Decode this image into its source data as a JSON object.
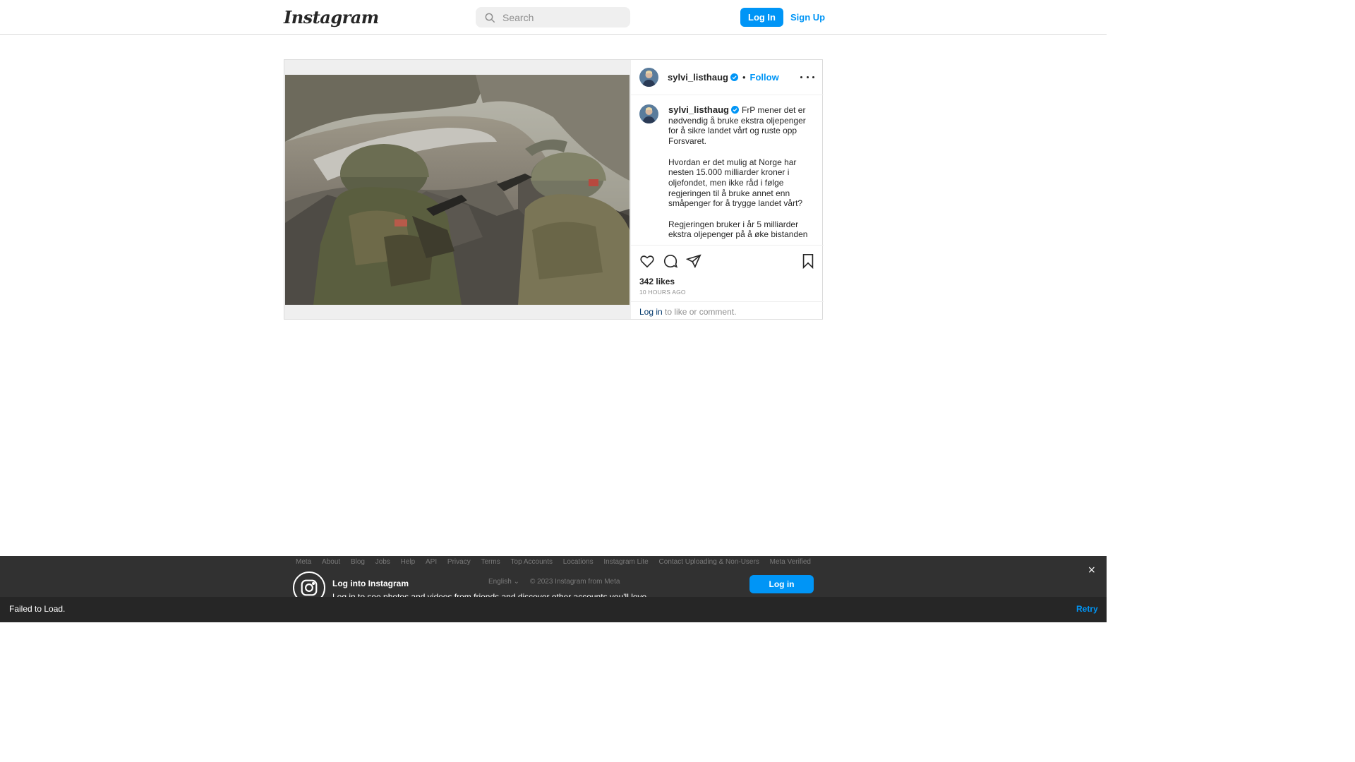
{
  "header": {
    "logo_text": "Instagram",
    "search_placeholder": "Search",
    "login_label": "Log In",
    "signup_label": "Sign Up"
  },
  "post": {
    "username": "sylvi_listhaug",
    "follow_label": "Follow",
    "separator": "•",
    "caption": "FrP mener det er nødvendig å bruke ekstra oljepenger for å sikre landet vårt og ruste opp Forsvaret.\n\nHvordan er det mulig at Norge har nesten 15.000 milliarder kroner i oljefondet, men ikke råd i følge regjeringen til å bruke annet enn småpenger for å trygge landet vårt?\n\nRegjeringen bruker i år 5 milliarder ekstra oljepenger på å øke bistanden",
    "likes": "342 likes",
    "time_ago": "10 HOURS AGO",
    "login_link": "Log in",
    "login_rest": " to like or comment."
  },
  "footer": {
    "links": [
      "Meta",
      "About",
      "Blog",
      "Jobs",
      "Help",
      "API",
      "Privacy",
      "Terms",
      "Top Accounts",
      "Locations",
      "Instagram Lite",
      "Contact Uploading & Non-Users",
      "Meta Verified"
    ]
  },
  "banner": {
    "title": "Log into Instagram",
    "subtitle": "Log in to see photos and videos from friends and discover other accounts you'll love.",
    "language": "English",
    "copyright": "© 2023 Instagram from Meta",
    "login_label": "Log in",
    "close_symbol": "×"
  },
  "toast": {
    "message": "Failed to Load.",
    "retry_label": "Retry"
  },
  "colors": {
    "accent": "#0095f6",
    "verified": "#0095f6",
    "banner_bg": "#262626"
  }
}
